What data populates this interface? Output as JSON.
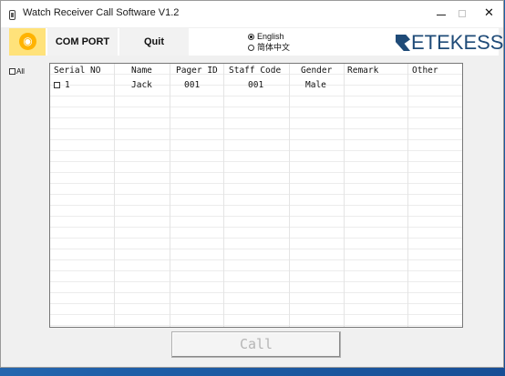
{
  "window": {
    "title": "Watch Receiver Call Software V1.2",
    "controls": {
      "minimize": "–",
      "maximize": "□",
      "close": "✕"
    }
  },
  "toolbar": {
    "com_port_label": "COM PORT",
    "quit_label": "Quit",
    "language": {
      "options": [
        "English",
        "简体中文"
      ],
      "selected": "English"
    },
    "brand": "ETEKESS"
  },
  "select_all_label": "All",
  "table": {
    "columns": [
      "Serial NO",
      "Name",
      "Pager ID",
      "Staff Code",
      "Gender",
      "Remark",
      "Other"
    ],
    "rows": [
      {
        "serial": "1",
        "name": "Jack",
        "pager_id": "001",
        "staff_code": "001",
        "gender": "Male",
        "remark": "",
        "other": ""
      }
    ]
  },
  "call_button_label": "Call",
  "colors": {
    "logo_background": "#ffe27a",
    "logo_icon": "#ffb300",
    "brand_text": "#1f4b78",
    "desktop": "#1f5fa8"
  }
}
